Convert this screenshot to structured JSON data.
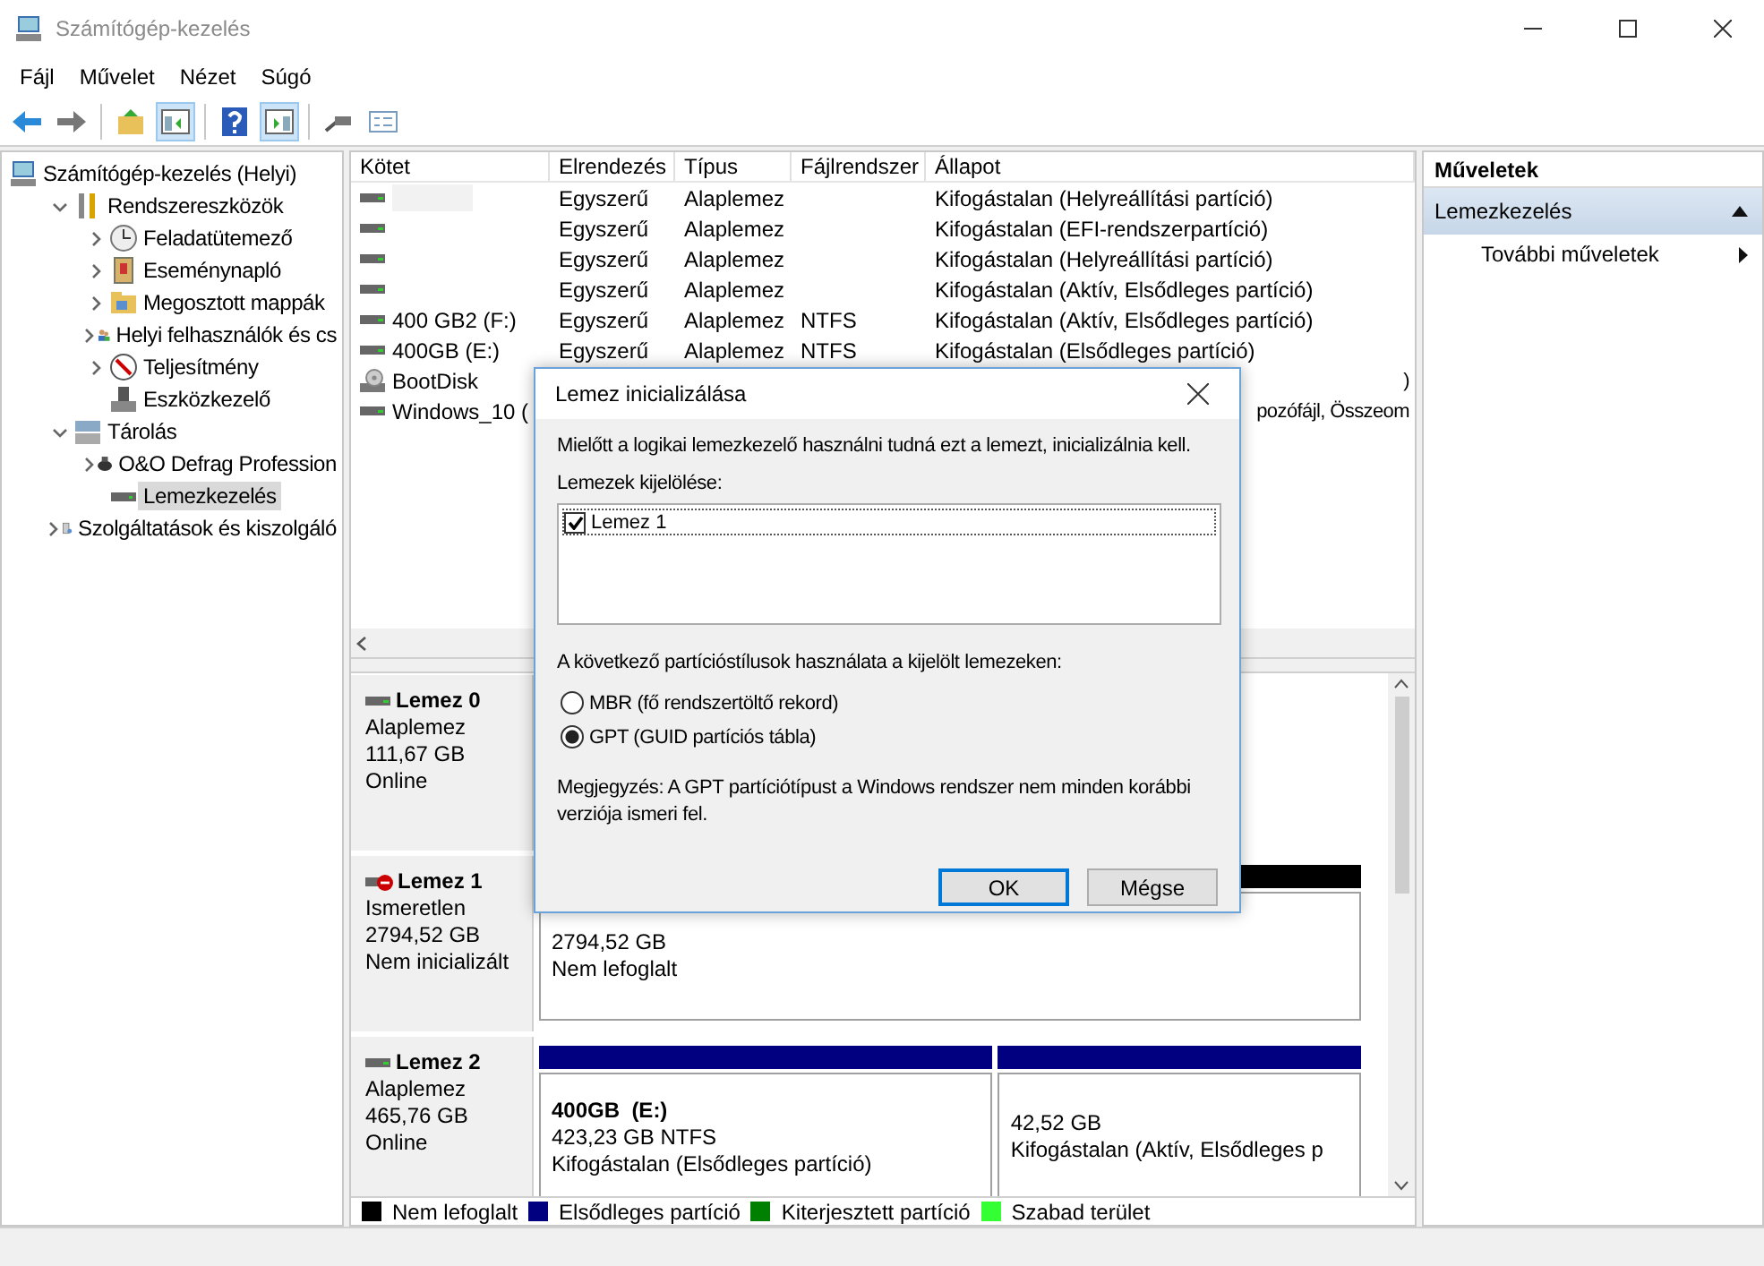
{
  "window": {
    "title": "Számítógép-kezelés"
  },
  "menu": [
    "Fájl",
    "Művelet",
    "Nézet",
    "Súgó"
  ],
  "tree": [
    {
      "label": "Számítógép-kezelés (Helyi)",
      "selected": false,
      "children": [
        {
          "label": "Rendszereszközök",
          "expanded": true,
          "selected": false,
          "children": [
            {
              "label": "Feladatütemező",
              "expanded": false,
              "selected": false
            },
            {
              "label": "Eseménynapló",
              "expanded": false,
              "selected": false
            },
            {
              "label": "Megosztott mappák",
              "expanded": false,
              "selected": false
            },
            {
              "label": "Helyi felhasználók és cs",
              "expanded": false,
              "selected": false
            },
            {
              "label": "Teljesítmény",
              "expanded": false,
              "selected": false
            },
            {
              "label": "Eszközkezelő",
              "selected": false
            }
          ]
        },
        {
          "label": "Tárolás",
          "expanded": true,
          "selected": false,
          "children": [
            {
              "label": "O&O Defrag Profession",
              "expanded": false,
              "selected": false
            },
            {
              "label": "Lemezkezelés",
              "selected": true
            }
          ]
        },
        {
          "label": "Szolgáltatások és kiszolgáló",
          "expanded": false,
          "selected": false
        }
      ]
    }
  ],
  "table": {
    "columns": [
      "Kötet",
      "Elrendezés",
      "Típus",
      "Fájlrendszer",
      "Állapot"
    ],
    "rows": [
      {
        "kind": "drive",
        "redacted": true,
        "layout": "Egyszerű",
        "type": "Alaplemez",
        "state": "Kifogástalan (Helyreállítási partíció)"
      },
      {
        "kind": "drive",
        "layout": "Egyszerű",
        "type": "Alaplemez",
        "state": "Kifogástalan (EFI-rendszerpartíció)"
      },
      {
        "kind": "drive",
        "layout": "Egyszerű",
        "type": "Alaplemez",
        "state": "Kifogástalan (Helyreállítási partíció)"
      },
      {
        "kind": "drive",
        "layout": "Egyszerű",
        "type": "Alaplemez",
        "state": "Kifogástalan (Aktív, Elsődleges partíció)"
      },
      {
        "kind": "drive",
        "volume": "400 GB2 (F:)",
        "layout": "Egyszerű",
        "type": "Alaplemez",
        "fs": "NTFS",
        "state": "Kifogástalan (Aktív, Elsődleges partíció)"
      },
      {
        "kind": "drive",
        "volume": "400GB (E:)",
        "layout": "Egyszerű",
        "type": "Alaplemez",
        "fs": "NTFS",
        "state": "Kifogástalan (Elsődleges partíció)"
      },
      {
        "kind": "optical",
        "volume": "BootDisk",
        "state_tail": ")"
      },
      {
        "kind": "drive",
        "volume": "Windows_10 (",
        "state_tail": "pozófájl, Összeom"
      }
    ]
  },
  "disks": [
    {
      "name": "Lemez 0",
      "error": false,
      "type": "Alaplemez",
      "size": "111,67 GB",
      "status": "Online"
    },
    {
      "name": "Lemez 1",
      "error": true,
      "type": "Ismeretlen",
      "size": "2794,52 GB",
      "status": "Nem inicializált",
      "partitions": [
        {
          "color": "#000000",
          "size": "2794,52 GB",
          "state": "Nem lefoglalt"
        }
      ]
    },
    {
      "name": "Lemez 2",
      "error": false,
      "type": "Alaplemez",
      "size": "465,76 GB",
      "status": "Online",
      "partitions": [
        {
          "color": "#000080",
          "name": "400GB  (E:)",
          "size": "423,23 GB NTFS",
          "state": "Kifogástalan (Elsődleges partíció)"
        },
        {
          "color": "#000080",
          "size": "42,52 GB",
          "state": "Kifogástalan (Aktív, Elsődleges p"
        }
      ]
    }
  ],
  "legend": [
    {
      "label": "Nem lefoglalt",
      "color": "#000000"
    },
    {
      "label": "Elsődleges partíció",
      "color": "#000080"
    },
    {
      "label": "Kiterjesztett partíció",
      "color": "#008000"
    },
    {
      "label": "Szabad terület",
      "color": "#33ff33"
    }
  ],
  "actions": {
    "title": "Műveletek",
    "section": "Lemezkezelés",
    "expanded": true,
    "items": [
      "További műveletek"
    ]
  },
  "dialog": {
    "title": "Lemez inicializálása",
    "intro": "Mielőtt a logikai lemezkezelő használni tudná ezt a lemezt, inicializálnia kell.",
    "list_label": "Lemezek kijelölése:",
    "disks": [
      {
        "label": "Lemez 1",
        "checked": true
      }
    ],
    "style_label": "A következő partícióstílusok használata a kijelölt lemezeken:",
    "options": [
      {
        "label": "MBR (fő rendszertöltő rekord)",
        "selected": false
      },
      {
        "label": "GPT (GUID partíciós tábla)",
        "selected": true
      }
    ],
    "note": "Megjegyzés: A GPT partíciótípust a Windows rendszer nem minden korábbi verziója ismeri fel.",
    "buttons": [
      {
        "label": "OK",
        "default": true
      },
      {
        "label": "Mégse",
        "default": false
      }
    ]
  }
}
